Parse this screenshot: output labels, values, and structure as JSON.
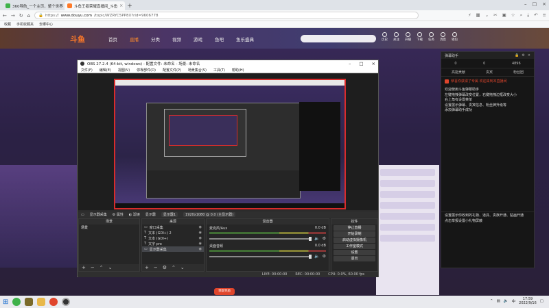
{
  "browser": {
    "tabs": [
      {
        "label": "360导航_一个主页，整个世界",
        "color": "#3fb24a",
        "active": false
      },
      {
        "label": "斗鱼王者荣耀直播间_斗鱼",
        "color": "#ff7a28",
        "active": true
      }
    ],
    "new_tab": "+",
    "url_prefix": "https://",
    "url_domain": "www.douyu.com",
    "url_path": "/topic/WZRYC5PP8X?rid=9606778",
    "bookmarks": [
      "收藏",
      "手机收藏夹",
      "去哪中心"
    ]
  },
  "site": {
    "logo": "斗鱼",
    "nav": [
      "首页",
      "直播",
      "分类",
      "视频",
      "游戏",
      "鱼吧",
      "鱼乐盛典"
    ],
    "nav_active": 1,
    "header_icons": [
      "历史",
      "关注",
      "开播",
      "下载",
      "任务",
      "消息",
      "钱包"
    ],
    "footer_button": "领取奖励"
  },
  "chat": {
    "header": "弹幕助手",
    "stats": [
      "0",
      "0",
      "4896"
    ],
    "tabs": [
      "高能贡献",
      "贵宾",
      "粉丝团"
    ],
    "notice": "恭喜你获得了专属 欢迎来到本直播间",
    "welcome": "欢迎使用斗鱼弹幕助手",
    "lines": [
      "左键拖拽弹幕改变位置，右键拖拽边框改变大小",
      "右上角有设置菜单",
      "设置展示弹幕、贵宾信息、粉丝牌升级等",
      "添加弹幕助手成功"
    ],
    "bottom_lines": [
      "设置展示你收到的礼物、道具、贵族开通、贴画开通",
      "点击举报设置小礼物屏蔽"
    ]
  },
  "obs": {
    "title": "OBS 27.2.4 (64-bit, windows) - 配置文件: 未命名 - 场景: 未命名",
    "menu": [
      "文件(F)",
      "编辑(E)",
      "视图(V)",
      "停靠部件(D)",
      "配置文件(P)",
      "场景集合(S)",
      "工具(T)",
      "帮助(H)"
    ],
    "info_bar": {
      "source": "显示器采集",
      "props": "属性",
      "filters": "滤镜",
      "display": "显示器",
      "display_value": "显示器1",
      "resolution": "1920x1080 @ 0,0 (主显示器)"
    },
    "docks": {
      "scenes": "场景",
      "sources": "来源",
      "mixer": "混音器",
      "controls": "控件"
    },
    "scenes": [
      "场景"
    ],
    "sources": [
      {
        "name": "窗口采集",
        "selected": false
      },
      {
        "name": "文本 (GDI+) 2",
        "selected": false
      },
      {
        "name": "文本 (GDI+)",
        "selected": false
      },
      {
        "name": "文字 pro",
        "selected": false
      },
      {
        "name": "显示器采集",
        "selected": true
      }
    ],
    "mixer": [
      {
        "name": "麦克风/Aux",
        "db": "0.0 dB"
      },
      {
        "name": "桌面音频",
        "db": "0.0 dB"
      }
    ],
    "controls": [
      "停止直播",
      "开始录制",
      "启动虚拟摄像机",
      "工作室模式",
      "设置",
      "退出"
    ],
    "status": [
      "LIVE: 00:00:00",
      "REC: 00:00:00",
      "CPU: 0.0%, 60.00 fps"
    ]
  },
  "taskbar": {
    "time": "17:59",
    "date": "2022/9/16",
    "lang": "中"
  }
}
